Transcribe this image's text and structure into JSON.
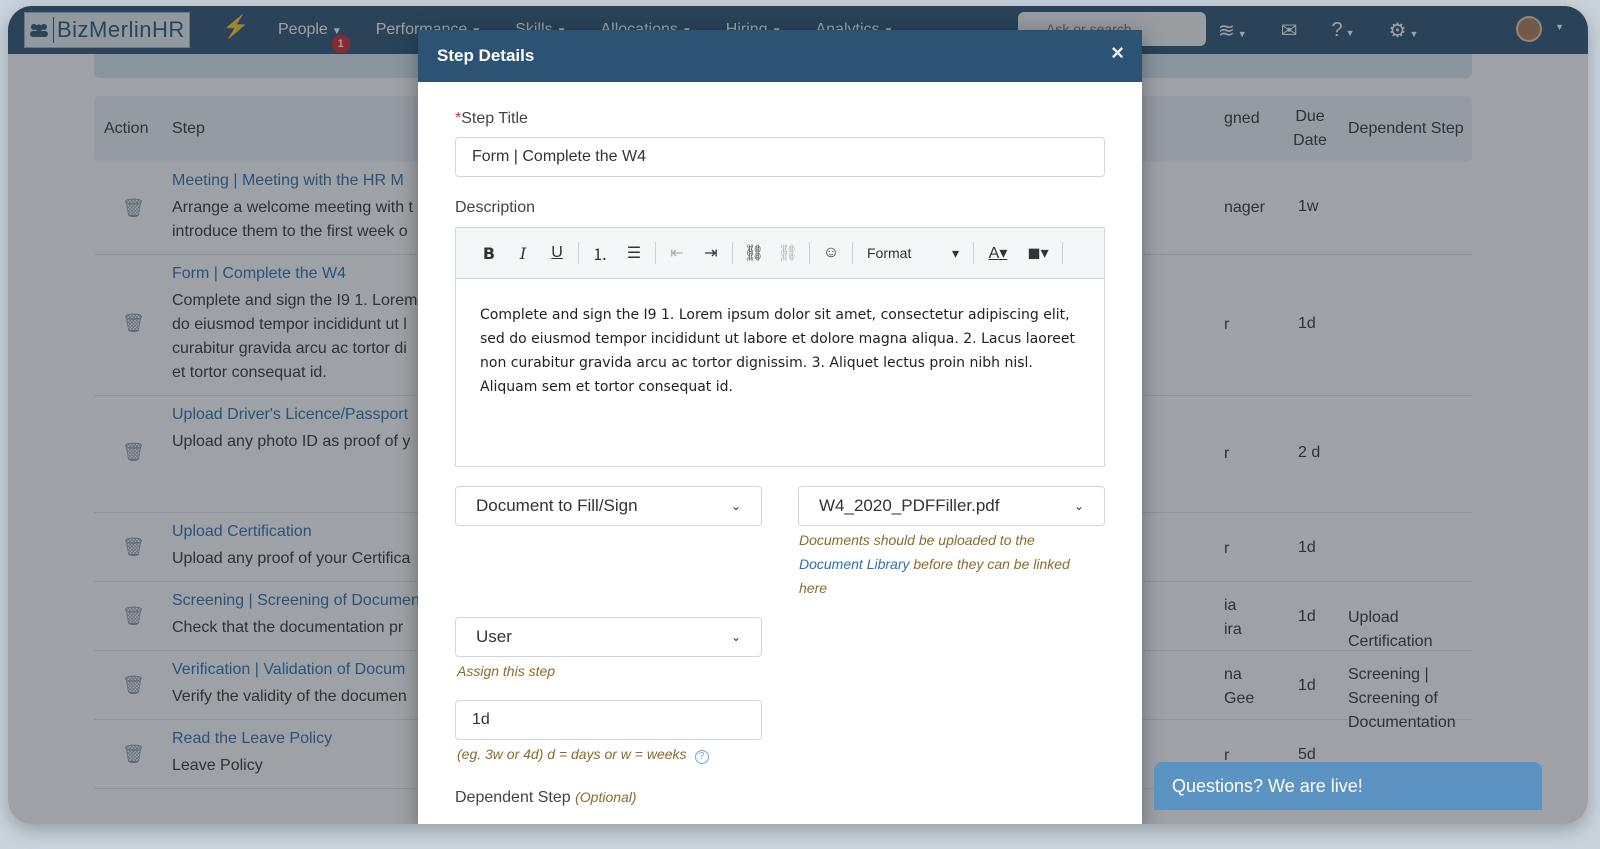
{
  "navbar": {
    "logo_text": "BizMerlinHR",
    "menu": [
      {
        "label": "People",
        "badge": "1"
      },
      {
        "label": "Performance"
      },
      {
        "label": "Skills"
      },
      {
        "label": "Allocations"
      },
      {
        "label": "Hiring"
      },
      {
        "label": "Analytics"
      }
    ],
    "search_placeholder": "Ask or search",
    "icons": [
      "layers-icon",
      "mail-icon",
      "help-icon",
      "gear-icon"
    ]
  },
  "table": {
    "headers": {
      "action": "Action",
      "step": "Step",
      "assigned": "gned",
      "due": "Due Date",
      "dependent": "Dependent Step"
    },
    "rows": [
      {
        "title": "Meeting | Meeting with the HR M",
        "desc": "Arrange a welcome meeting with t\nintroduce them to the first week o",
        "assigned": "nager",
        "due": "1w",
        "dependent": ""
      },
      {
        "title": "Form | Complete the W4",
        "desc": "Complete and sign the I9 1. Lorem\ndo eiusmod tempor incididunt ut l\ncurabitur gravida arcu ac tortor di\net tortor consequat id.",
        "assigned": "r",
        "due": "1d",
        "dependent": ""
      },
      {
        "title": "Upload Driver's Licence/Passport",
        "desc": "Upload any photo ID as proof of y",
        "assigned": "r",
        "due": "2 d",
        "dependent": ""
      },
      {
        "title": "Upload Certification",
        "desc": "Upload any proof of your Certifica",
        "assigned": "r",
        "due": "1d",
        "dependent": ""
      },
      {
        "title": "Screening | Screening of Documen",
        "desc": "Check that the documentation pr",
        "assigned": "ia\nira",
        "due": "1d",
        "dependent": "Upload Certification"
      },
      {
        "title": "Verification | Validation of Docum",
        "desc": "Verify the validity of the documen",
        "assigned": "na\nGee",
        "due": "1d",
        "dependent": "Screening | Screening of\nDocumentation"
      },
      {
        "title": "Read the Leave Policy",
        "desc": "Leave Policy",
        "assigned": "r",
        "due": "5d",
        "dependent": ""
      }
    ]
  },
  "modal": {
    "title": "Step Details",
    "close": "×",
    "step_title_label": "Step Title",
    "step_title_required": "*",
    "step_title_value": "Form | Complete the W4",
    "description_label": "Description",
    "toolbar": {
      "bold": "B",
      "italic": "I",
      "underline": "U",
      "format": "Format"
    },
    "description_value": "Complete and sign the I9 1. Lorem ipsum dolor sit amet, consectetur adipiscing elit, sed do eiusmod tempor incididunt ut labore et dolore magna aliqua. 2. Lacus laoreet non curabitur gravida arcu ac tortor dignissim. 3. Aliquet lectus proin nibh nisl. Aliquam sem et tortor consequat id.",
    "step_type_value": "Document to Fill/Sign",
    "document_value": "W4_2020_PDFFiller.pdf",
    "document_hint_before": "Documents should be uploaded to the",
    "document_hint_link": "Document Library",
    "document_hint_after": "before they can be linked here",
    "assignee_value": "User",
    "assignee_hint": "Assign this step",
    "due_value": "1d",
    "due_hint": "(eg. 3w or 4d) d = days or w = weeks",
    "dependent_label": "Dependent Step",
    "dependent_optional": "(Optional)"
  },
  "chat": {
    "label": "Questions? We are live!"
  }
}
